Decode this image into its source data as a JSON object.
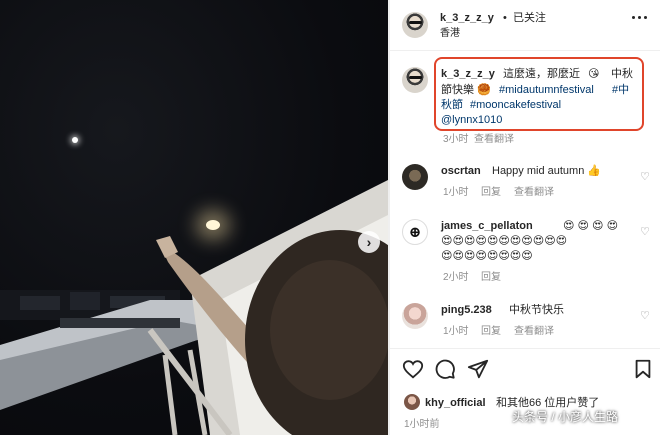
{
  "post": {
    "author": "k_3_z_z_y",
    "separator": "•",
    "follow_status": "已关注",
    "location": "香港",
    "more_icon": "more-dots-icon"
  },
  "caption": {
    "author": "k_3_z_z_y",
    "line1_text": "這麼遠，那麼近",
    "line1_emoji": "😘",
    "line1_text2": "中秋",
    "line2_text": "節快樂",
    "line2_emoji": "🥮",
    "tag1": "#midautumnfestival",
    "tag2a": "#中",
    "line3_text": "秋節",
    "tag3": "#mooncakefestival",
    "mention": "@lynnx1010",
    "time": "3小时",
    "translate": "查看翻译"
  },
  "comments": [
    {
      "user": "oscrtan",
      "text": "Happy mid autumn 👍",
      "time": "1小时",
      "reply": "回复",
      "translate": "查看翻译"
    },
    {
      "user": "james_c_pellaton",
      "emojis_line1": "😍 😍 😍 😍",
      "emojis_line2": "😍😍😍😍😍😍😍😍😍😍😍",
      "emojis_line3": "😍😍😍😍😍😍😍😍",
      "time": "2小时",
      "reply": "回复"
    },
    {
      "user": "ping5.238",
      "text": "中秋节快乐",
      "time": "1小时",
      "reply": "回复",
      "translate": "查看翻译"
    }
  ],
  "likes": {
    "user": "khy_official",
    "text": "和其他66 位用户赞了"
  },
  "post_time": "1小时前",
  "watermark": "头条号 / 小彦人生路",
  "colors": {
    "highlight_box": "#e0452b",
    "link": "#00376b",
    "muted": "#8e8e8e"
  }
}
